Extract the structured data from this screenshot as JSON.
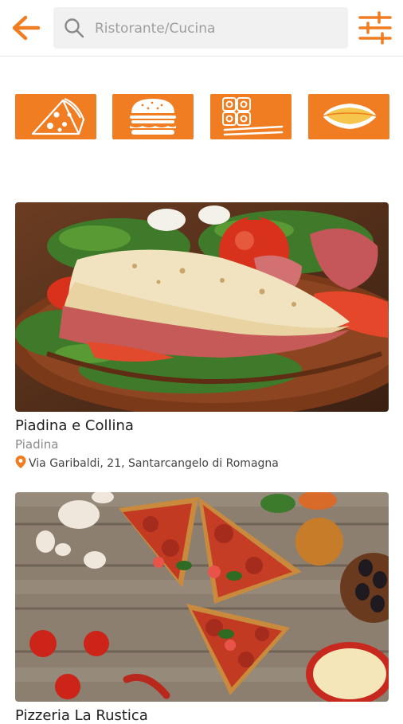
{
  "search": {
    "placeholder": "Ristorante/Cucina"
  },
  "icons": {
    "back": "arrow-left-icon",
    "search": "search-icon",
    "filter": "sliders-icon",
    "pin": "location-pin-icon"
  },
  "colors": {
    "accent": "#f07d22"
  },
  "categories": [
    {
      "icon": "pizza-slice-icon"
    },
    {
      "icon": "burger-icon"
    },
    {
      "icon": "sushi-icon"
    },
    {
      "icon": "piadina-icon"
    }
  ],
  "restaurants": [
    {
      "name": "Piadina e Collina",
      "cuisine": "Piadina",
      "address": "Via Garibaldi, 21, Santarcangelo di Romagna"
    },
    {
      "name": "Pizzeria La Rustica"
    }
  ]
}
